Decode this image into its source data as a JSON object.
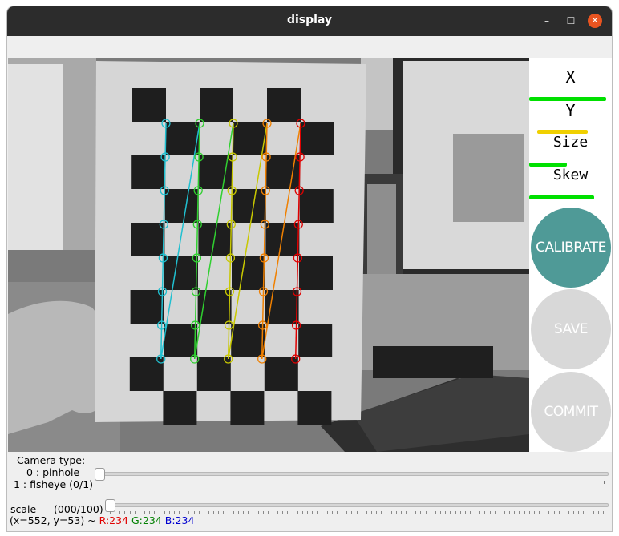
{
  "window": {
    "title": "display",
    "buttons": {
      "minimize": "–",
      "maximize": "☐",
      "close": "✕"
    }
  },
  "panel": {
    "metrics": [
      {
        "label": "X",
        "level": 0.96,
        "color": "#00e000"
      },
      {
        "label": "Y",
        "level": 0.63,
        "color": "#f0d000"
      },
      {
        "label": "Size",
        "level": 0.47,
        "color": "#00e000"
      },
      {
        "label": "Skew",
        "level": 0.81,
        "color": "#00e000"
      }
    ],
    "buttons": {
      "calibrate": {
        "label": "CALIBRATE",
        "color": "#4f9a97",
        "enabled": true
      },
      "save": {
        "label": "SAVE",
        "color": "#d8d8d8",
        "enabled": false
      },
      "commit": {
        "label": "COMMIT",
        "color": "#d8d8d8",
        "enabled": false
      }
    }
  },
  "trackbars": {
    "camera_type": {
      "label_line1": "Camera type:",
      "label_line2": "0 : pinhole",
      "label_line3": "1 : fisheye (0/1)",
      "value": 0
    },
    "scale": {
      "label": "scale",
      "value_text": "(000/100)",
      "value": 0
    }
  },
  "status_bar": {
    "coords": "(x=552, y=53) ~",
    "r": "R:234",
    "g": "G:234",
    "b": "B:234",
    "r_color": "#e00000",
    "g_color": "#008000",
    "b_color": "#0000d0"
  },
  "detection_colors": [
    "#20c0d0",
    "#30d030",
    "#c8c800",
    "#f08000",
    "#e00000"
  ]
}
